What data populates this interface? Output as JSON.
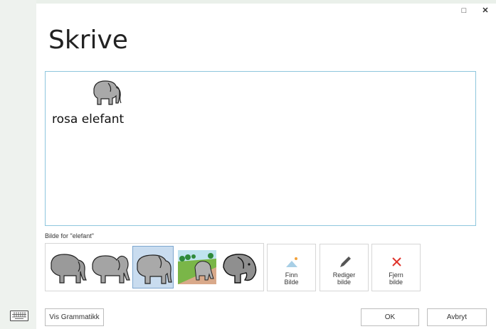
{
  "window": {
    "maximize_glyph": "□",
    "close_glyph": "✕"
  },
  "dialog": {
    "title": "Skrive"
  },
  "editor": {
    "symbol_icon": "elephant-icon",
    "text": "rosa elefant"
  },
  "picker": {
    "label": "Bilde for \"elefant\"",
    "options": [
      {
        "icon": "elephant-icon",
        "selected": false
      },
      {
        "icon": "elephant-icon",
        "selected": false
      },
      {
        "icon": "elephant-icon",
        "selected": true
      },
      {
        "icon": "elephant-scene-icon",
        "selected": false
      },
      {
        "icon": "elephant-icon",
        "selected": false
      }
    ]
  },
  "actions": {
    "find": {
      "line1": "Finn",
      "line2": "Bilde",
      "icon": "image-icon"
    },
    "edit": {
      "line1": "Rediger",
      "line2": "bilde",
      "icon": "pencil-icon"
    },
    "remove": {
      "line1": "Fjern",
      "line2": "bilde",
      "icon": "close-icon",
      "color": "#e0342c"
    }
  },
  "footer": {
    "grammar_label": "Vis Grammatikk",
    "ok_label": "OK",
    "cancel_label": "Avbryt"
  },
  "sidebar": {
    "keyboard_icon": "keyboard-icon"
  }
}
